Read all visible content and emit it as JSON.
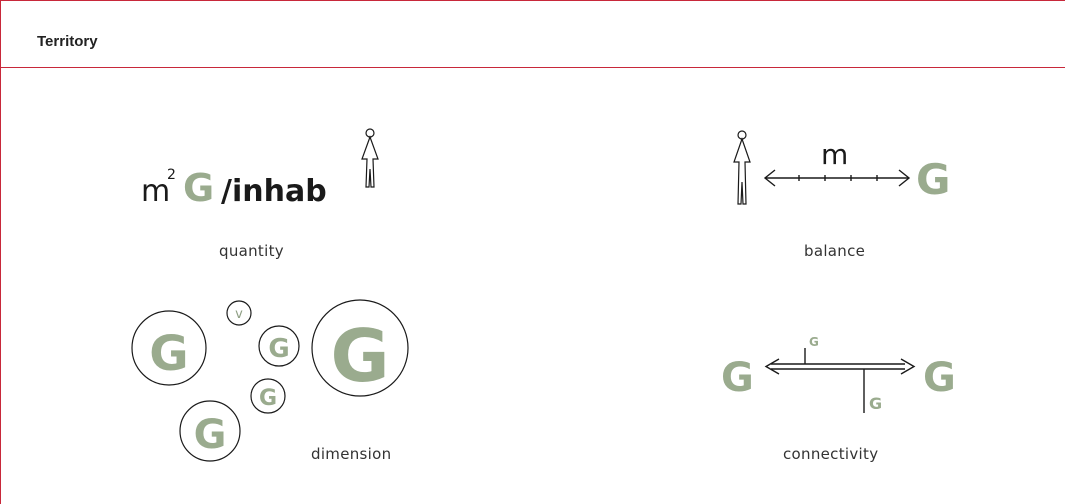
{
  "header": {
    "title": "Territory"
  },
  "colors": {
    "accent": "#c8283a",
    "green_g": "#9aab8e"
  },
  "items": [
    {
      "caption": "quantity",
      "formula": {
        "unit": "m",
        "exponent": "2",
        "letter": "G",
        "rest": "/inhab"
      }
    },
    {
      "caption": "balance",
      "label": "m",
      "letter": "G"
    },
    {
      "caption": "dimension",
      "small_letter": "v",
      "letter": "G"
    },
    {
      "caption": "connectivity",
      "letter": "G"
    }
  ]
}
